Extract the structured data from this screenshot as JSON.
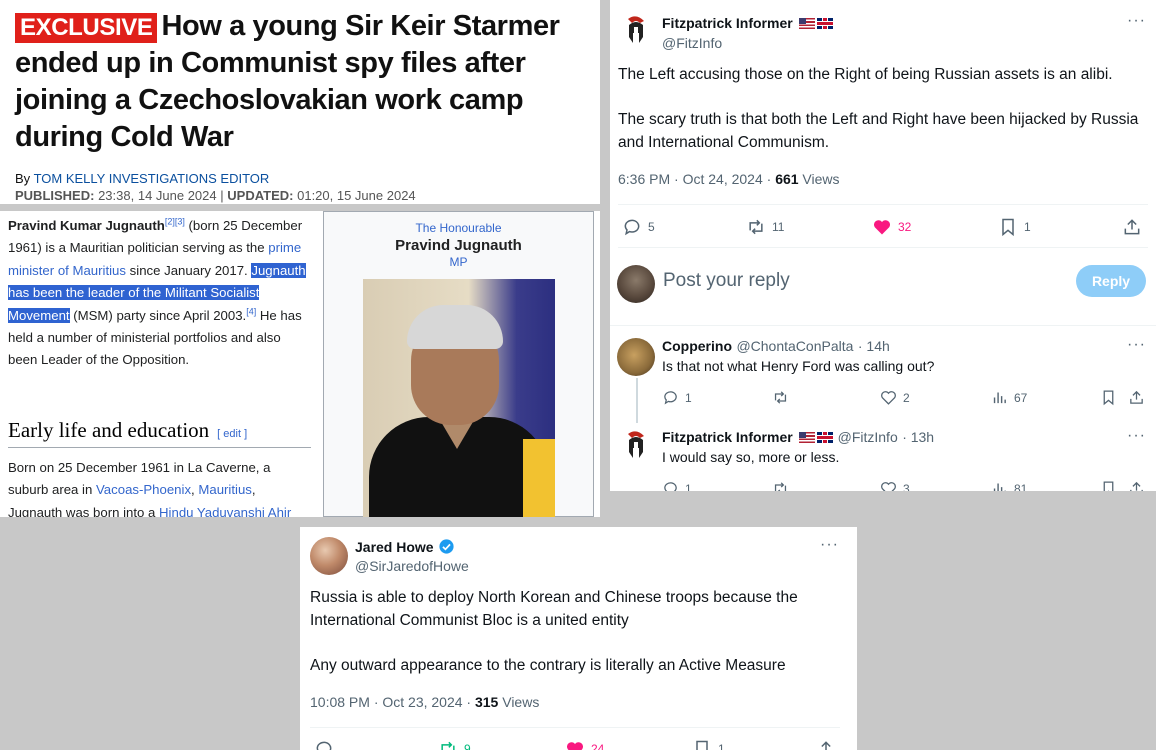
{
  "article": {
    "badge": "EXCLUSIVE",
    "headline": "How a young Sir Keir Starmer ended up in Communist spy files after joining a Czechoslovakian work camp during Cold War",
    "by": "By",
    "author": "TOM KELLY INVESTIGATIONS EDITOR",
    "published_label": "PUBLISHED:",
    "published": "23:38, 14 June 2024",
    "sep": "|",
    "updated_label": "UPDATED:",
    "updated": "01:20, 15 June 2024"
  },
  "wiki": {
    "name": "Pravind Kumar Jugnauth",
    "ref1": "[2][3]",
    "p1a": " (born 25 December 1961) is a Mauritian politician serving as the ",
    "link_pm": "prime minister of Mauritius",
    "p1b": " since January 2017. ",
    "highlight": "Jugnauth has been the leader of the Militant Socialist Movement",
    "p1c": " (MSM) party since April 2003.",
    "ref2": "[4]",
    "p1d": " He has held a number of ministerial portfolios and also been Leader of the Opposition.",
    "heading": "Early life and education",
    "edit": "[ edit ]",
    "p2a": "Born on 25 December 1961 in La Caverne, a suburb area in ",
    "link_vp": "Vacoas-Phoenix",
    "p2b": ", ",
    "link_mu": "Mauritius",
    "p2c": ", Jugnauth was born into a ",
    "link_hy": "Hindu Yaduvanshi Ahir",
    "infobox": {
      "honorific": "The Honourable",
      "name": "Pravind Jugnauth",
      "post": "MP"
    }
  },
  "fitz_tweet": {
    "name": "Fitzpatrick Informer",
    "handle": "@FitzInfo",
    "more": "···",
    "para1": "The Left accusing those on the Right of being Russian assets is an alibi.",
    "para2": "The scary truth is that both the Left and Right have been hijacked by Russia and International Communism.",
    "time": "6:36 PM · Oct 24, 2024 · ",
    "views_count": "661",
    "views_label": " Views",
    "replies": "5",
    "reposts": "11",
    "likes": "32",
    "bookmarks": "1",
    "reply_placeholder": "Post your reply",
    "reply_button": "Reply"
  },
  "reply1": {
    "name": "Copperino",
    "handle": "@ChontaConPalta",
    "time": "· 14h",
    "more": "···",
    "text": "Is that not what Henry Ford was calling out?",
    "replies": "1",
    "likes": "2",
    "views": "67"
  },
  "reply2": {
    "name": "Fitzpatrick Informer",
    "handle": "@FitzInfo",
    "time": "· 13h",
    "more": "···",
    "text": "I would say so, more or less.",
    "replies": "1",
    "likes": "3",
    "views": "81"
  },
  "jared_tweet": {
    "name": "Jared Howe",
    "handle": "@SirJaredofHowe",
    "more": "···",
    "para1": "Russia is able to deploy North Korean and Chinese troops because the International Communist Bloc is a united entity",
    "para2": "Any outward appearance to the contrary is literally an Active Measure",
    "time": "10:08 PM · Oct 23, 2024 · ",
    "views_count": "315",
    "views_label": " Views",
    "reposts": "9",
    "likes": "24",
    "bookmarks": "1"
  },
  "colors": {
    "like": "#f91880",
    "link": "#3366cc",
    "highlight": "#2f63d1",
    "badge": "#e0201a",
    "verified": "#1d9bf0"
  }
}
